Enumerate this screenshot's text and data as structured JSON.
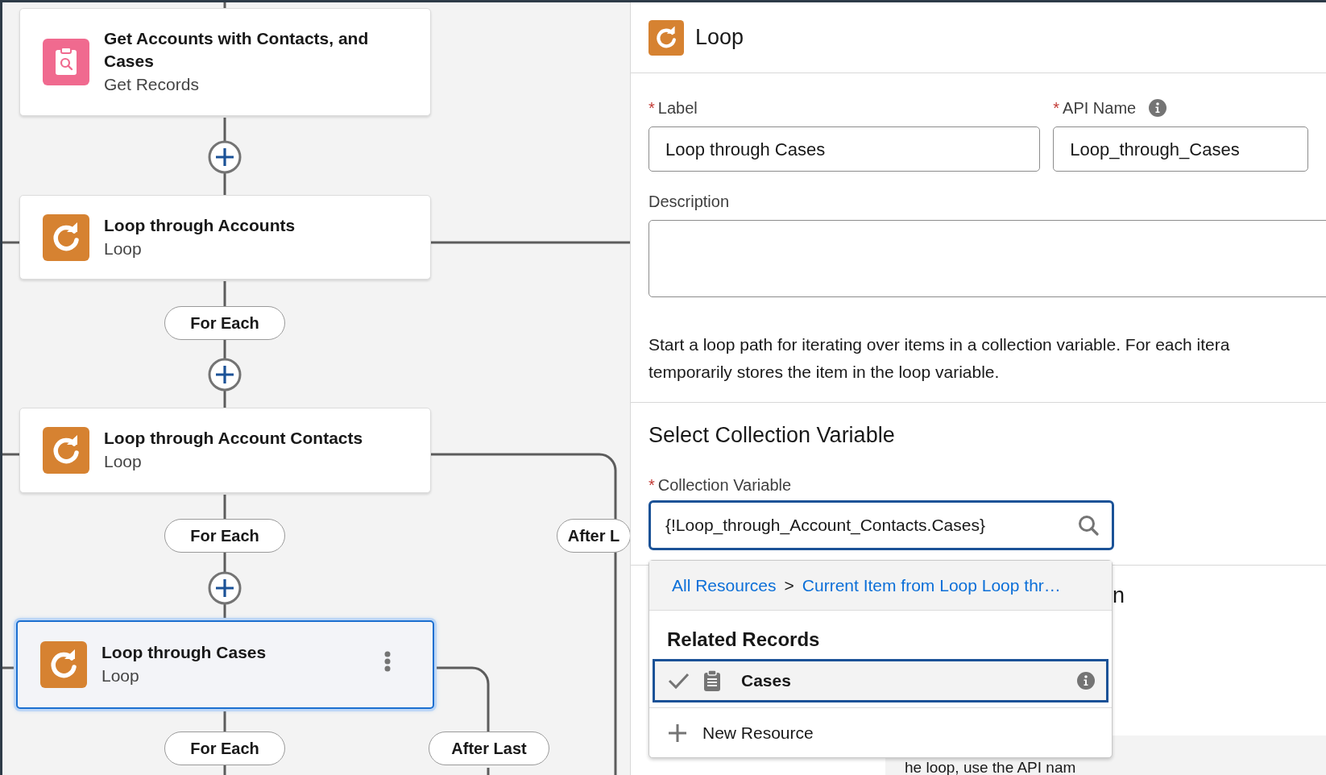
{
  "canvas": {
    "nodes": [
      {
        "kind": "get_records",
        "title": "Get Accounts with Contacts, and Cases",
        "subtitle": "Get Records",
        "selected": false
      },
      {
        "kind": "loop",
        "title": "Loop through Accounts",
        "subtitle": "Loop",
        "selected": false
      },
      {
        "kind": "loop",
        "title": "Loop through Account Contacts",
        "subtitle": "Loop",
        "selected": false
      },
      {
        "kind": "loop",
        "title": "Loop through Cases",
        "subtitle": "Loop",
        "selected": true
      }
    ],
    "path_labels": [
      {
        "label": "For Each"
      },
      {
        "label": "For Each"
      },
      {
        "label": "After L"
      },
      {
        "label": "For Each"
      },
      {
        "label": "After Last"
      }
    ]
  },
  "panel": {
    "title": "Loop",
    "label_field": {
      "required_mark": "*",
      "label": "Label",
      "value": "Loop through Cases"
    },
    "api_name_field": {
      "required_mark": "*",
      "label": "API Name",
      "value": "Loop_through_Cases"
    },
    "description_field": {
      "label": "Description"
    },
    "help_text": [
      "Start a loop path for iterating over items in a collection variable. For each itera",
      "temporarily stores the item in the loop variable."
    ],
    "section_heading": "Select Collection Variable",
    "collection_field": {
      "required_mark": "*",
      "label": "Collection Variable",
      "value": "{!Loop_through_Account_Contacts.Cases}"
    },
    "dropdown": {
      "breadcrumb": [
        "All Resources",
        "Current Item from Loop Loop thr…"
      ],
      "separator": ">",
      "group": "Related Records",
      "options": [
        {
          "label": "Cases",
          "selected": true
        }
      ],
      "new_resource": "New Resource"
    },
    "covered_heading_fragment": "n",
    "covered_text_fragment": "he loop, use the API nam"
  }
}
